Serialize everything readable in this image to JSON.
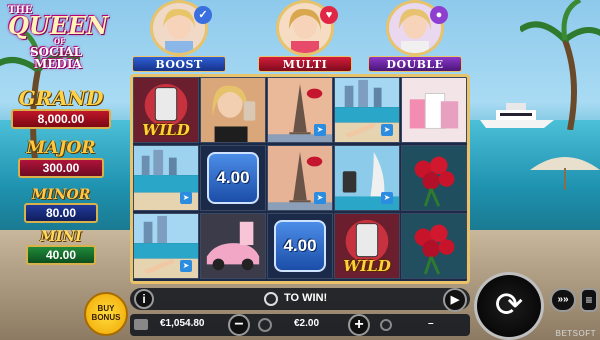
{
  "logo": {
    "line1": "THE",
    "line2": "QUEEN",
    "line3": "OF",
    "line4": "SOCIAL",
    "line5": "MEDIA"
  },
  "jackpots": {
    "grand": {
      "name": "GRAND",
      "value": "8,000.00"
    },
    "major": {
      "name": "MAJOR",
      "value": "300.00"
    },
    "minor": {
      "name": "MINOR",
      "value": "80.00"
    },
    "mini": {
      "name": "MINI",
      "value": "40.00"
    }
  },
  "features": {
    "boost": {
      "title": "BOOST",
      "badge": "thumbs-up-icon"
    },
    "multi": {
      "title": "MULTI",
      "badge": "heart-icon"
    },
    "double": {
      "title": "DOUBLE",
      "badge": "person-icon"
    }
  },
  "reels": [
    [
      {
        "symbol": "phone-wild",
        "label": "WILD"
      },
      {
        "symbol": "city-beach"
      },
      {
        "symbol": "city-beach-legs"
      }
    ],
    [
      {
        "symbol": "influencer-woman"
      },
      {
        "symbol": "thumbs-up-bonus",
        "value": "4.00"
      },
      {
        "symbol": "pink-sports-car"
      }
    ],
    [
      {
        "symbol": "paris-eiffel"
      },
      {
        "symbol": "paris-eiffel"
      },
      {
        "symbol": "thumbs-up-bonus",
        "value": "4.00"
      }
    ],
    [
      {
        "symbol": "city-beach-legs"
      },
      {
        "symbol": "dubai-burj"
      },
      {
        "symbol": "phone-wild",
        "label": "WILD"
      }
    ],
    [
      {
        "symbol": "shopping-bags"
      },
      {
        "symbol": "roses"
      },
      {
        "symbol": "roses"
      }
    ]
  ],
  "controls": {
    "info": "i",
    "to_win": "TO WIN!",
    "buy_bonus_line1": "BUY",
    "buy_bonus_line2": "BONUS",
    "balance": "€1,054.80",
    "bet": "€2.00",
    "win": "–",
    "minus": "−",
    "plus": "+",
    "spin": "⟳",
    "play": "▶",
    "fast": "»»",
    "menu": "≡"
  },
  "brand": "BETSOFT"
}
